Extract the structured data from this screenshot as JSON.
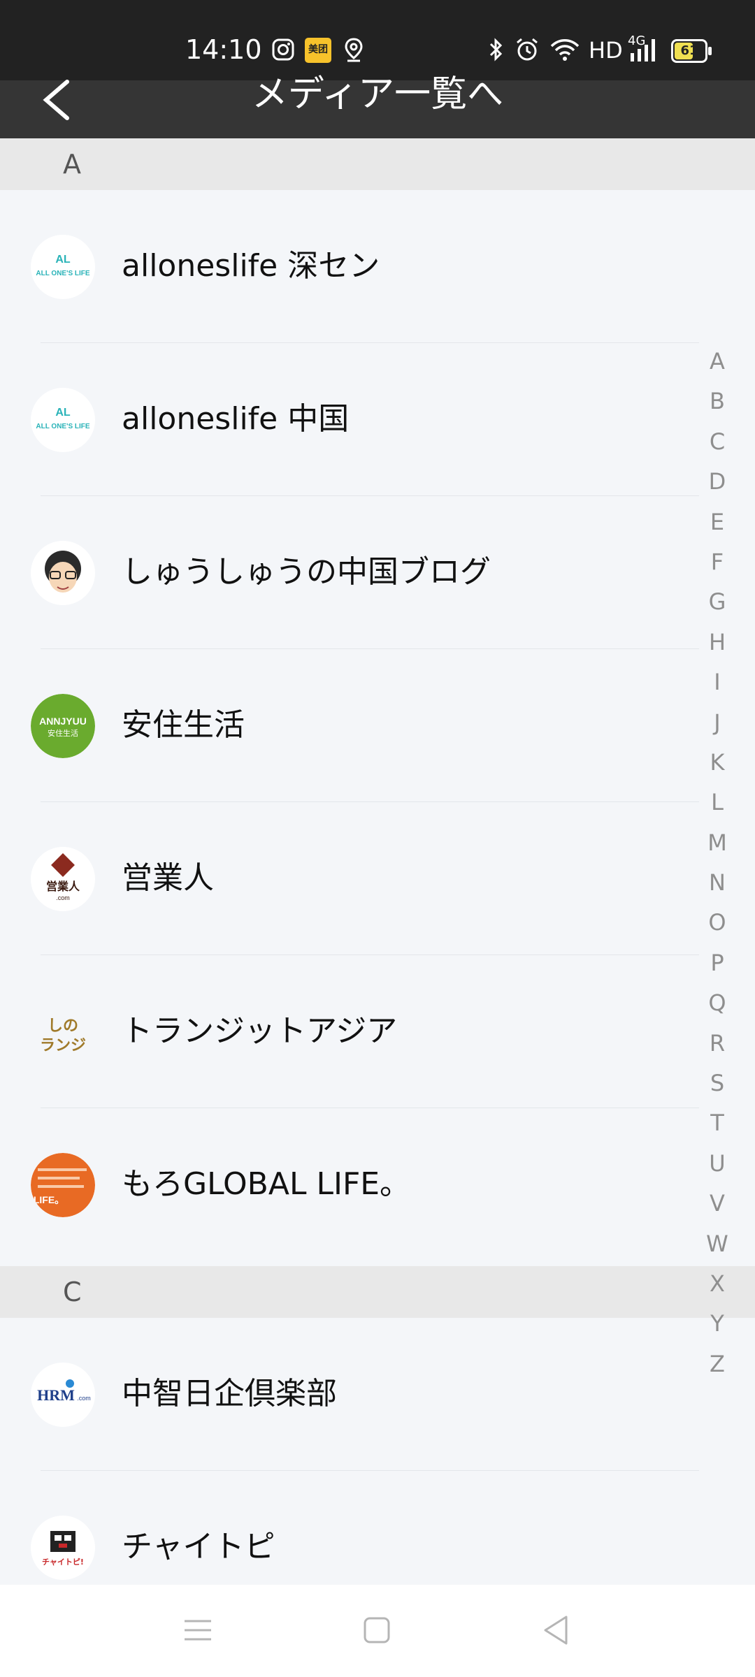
{
  "status_bar": {
    "time": "14:10",
    "hd_label": "HD",
    "network_label": "4G",
    "battery": "61",
    "meituan_label": "美团",
    "icons": [
      "instagram-icon",
      "meituan-icon",
      "location-icon",
      "bluetooth-icon",
      "alarm-icon",
      "wifi-icon",
      "signal-icon",
      "battery-icon"
    ]
  },
  "header": {
    "back_icon": "chevron-left-icon",
    "title": "メディア一覧へ"
  },
  "sections": [
    {
      "letter": "A",
      "items": [
        {
          "name": "alloneslife 深セン",
          "avatar_text": "ALL ONE'S LIFE",
          "avatar_color": "#2ab3b8"
        },
        {
          "name": "alloneslife 中国",
          "avatar_text": "ALL ONE'S LIFE",
          "avatar_color": "#2ab3b8"
        },
        {
          "name": "しゅうしゅうの中国ブログ",
          "avatar_text": "",
          "avatar_color": "#333333"
        },
        {
          "name": "安住生活",
          "avatar_text": "ANNJYUU",
          "avatar_text2": "安住生活",
          "avatar_color": "#6aab2e"
        },
        {
          "name": "営業人",
          "avatar_text": "営業人",
          "avatar_text2": ".com",
          "avatar_color": "#8b2a1f"
        },
        {
          "name": "トランジットアジア",
          "avatar_text": "しの",
          "avatar_text2": "ランジ",
          "avatar_color": "#a07a2a"
        },
        {
          "name": "もろGLOBAL LIFE。",
          "avatar_text": "LIFE。",
          "avatar_color": "#e86a24"
        }
      ]
    },
    {
      "letter": "C",
      "items": [
        {
          "name": "中智日企倶楽部",
          "avatar_text": "HRM",
          "avatar_text2": ".com",
          "avatar_color": "#1f3f8a"
        },
        {
          "name": "チャイトピ",
          "avatar_text": "チャイトピ!",
          "avatar_color": "#c8282a"
        }
      ]
    }
  ],
  "alphabet": [
    "A",
    "B",
    "C",
    "D",
    "E",
    "F",
    "G",
    "H",
    "I",
    "J",
    "K",
    "L",
    "M",
    "N",
    "O",
    "P",
    "Q",
    "R",
    "S",
    "T",
    "U",
    "V",
    "W",
    "X",
    "Y",
    "Z"
  ],
  "nav_bar": {
    "icons": [
      "menu-icon",
      "home-square-icon",
      "back-triangle-icon"
    ]
  },
  "colors": {
    "status_bar_bg": "#222222",
    "header_bg": "#353535",
    "section_bg": "#e8e8e8",
    "list_bg": "#f4f6f9",
    "index_text": "#8e8e8e"
  }
}
